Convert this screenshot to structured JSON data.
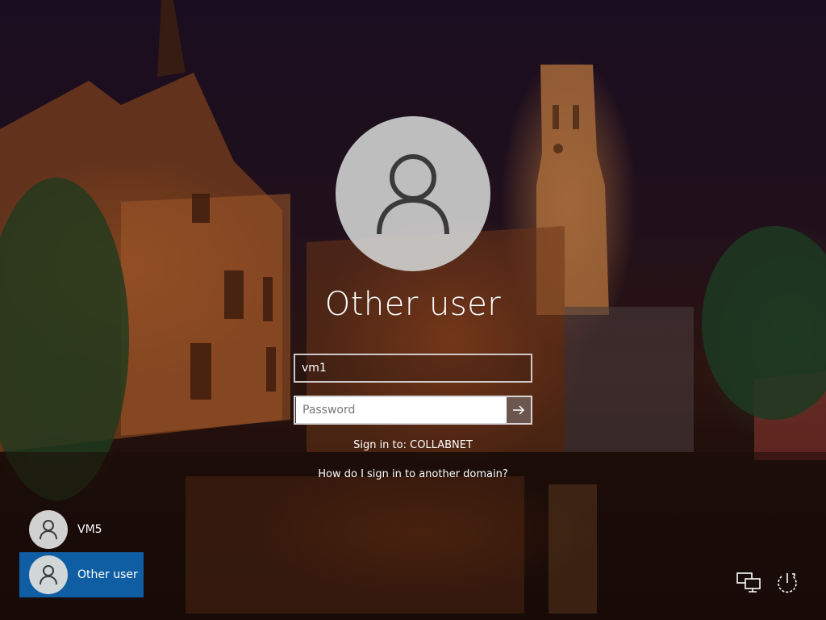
{
  "login": {
    "display_name": "Other user",
    "username_value": "vm1",
    "password_placeholder": "Password",
    "sign_in_to": "Sign in to: COLLABNET",
    "other_domain_link": "How do I sign in to another domain?"
  },
  "users": [
    {
      "label": "VM5",
      "selected": false
    },
    {
      "label": "Other user",
      "selected": true
    }
  ],
  "corner_icons": [
    "network-icon",
    "power-icon"
  ],
  "colors": {
    "selected_tile": "#0f5ea3",
    "avatar_bg": "#cdcdcd",
    "text": "#ffffff"
  }
}
